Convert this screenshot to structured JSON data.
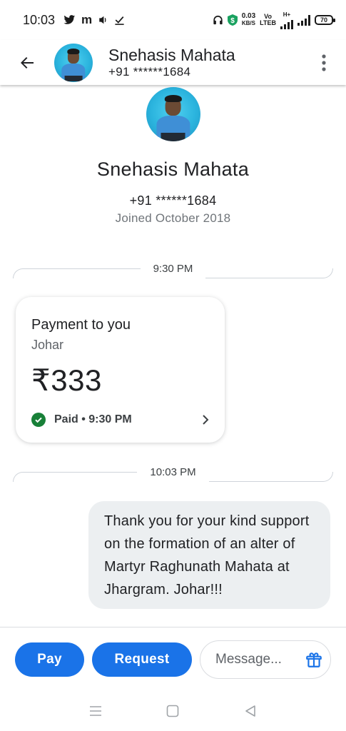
{
  "status_bar": {
    "time": "10:03",
    "speed_top": "0.03",
    "speed_bottom": "KB/S",
    "volte_top": "Vo",
    "volte_bottom": "LTEB",
    "network_tag": "H+",
    "battery": "70"
  },
  "header": {
    "name": "Snehasis Mahata",
    "phone": "+91 ******1684"
  },
  "profile": {
    "name": "Snehasis Mahata",
    "phone": "+91 ******1684",
    "joined": "Joined October 2018"
  },
  "conversation": {
    "divider_1": "9:30 PM",
    "payment": {
      "title": "Payment to you",
      "note": "Johar",
      "amount": "₹333",
      "status": "Paid • 9:30 PM"
    },
    "divider_2": "10:03 PM",
    "message": "Thank you for your kind support on the formation of an alter of Martyr Raghunath Mahata at Jhargram. Johar!!!"
  },
  "actions": {
    "pay": "Pay",
    "request": "Request",
    "message_placeholder": "Message..."
  },
  "colors": {
    "accent": "#1a73e8",
    "paid_green": "#188038",
    "bubble": "#eceff1"
  }
}
